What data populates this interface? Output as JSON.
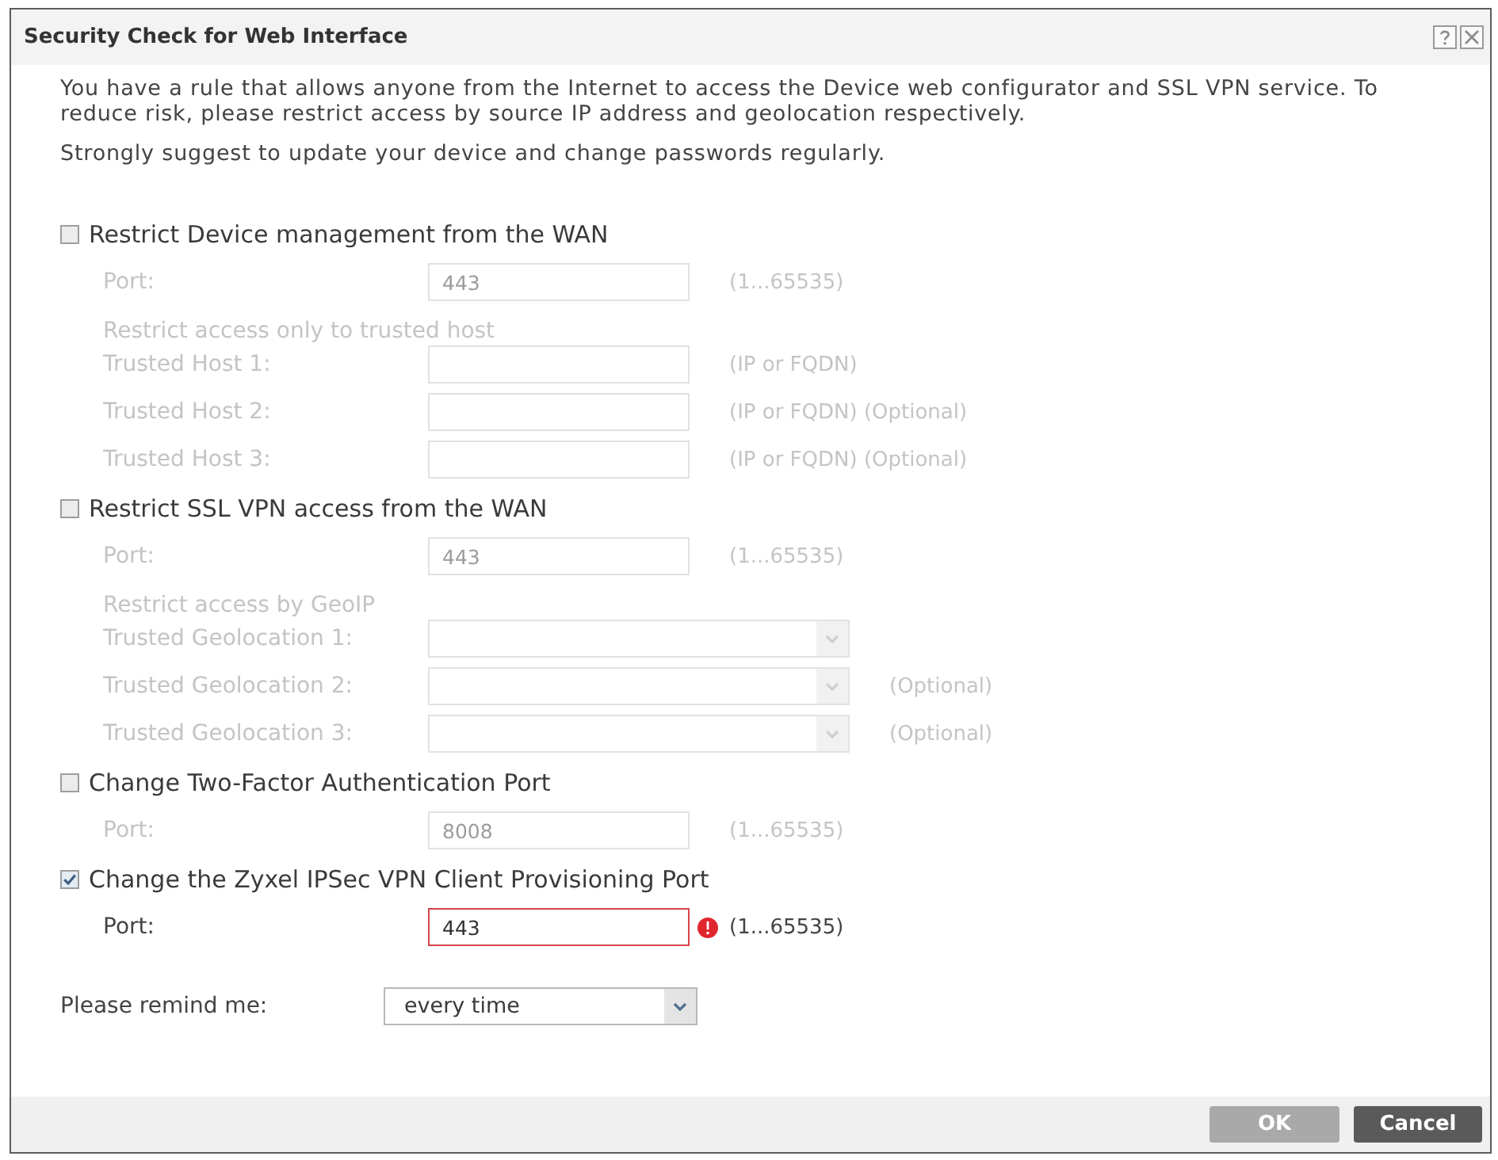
{
  "window": {
    "title": "Security Check for Web Interface"
  },
  "message": [
    "You have a rule that allows anyone from the Internet to access the Device web configurator and SSL VPN service. To reduce risk, please restrict access by source IP address and geolocation respectively.",
    "Strongly suggest to update your device and change passwords regularly."
  ],
  "sections": [
    {
      "label": "Restrict Device management from the WAN",
      "checked": false,
      "rows": [
        {
          "kind": "input",
          "label": "Port:",
          "value": "443",
          "hint": "(1...65535)",
          "error": false
        },
        {
          "kind": "note",
          "label": "Restrict access only to trusted host"
        },
        {
          "kind": "input",
          "label": "Trusted Host 1:",
          "hint": "(IP or FQDN)",
          "error": false
        },
        {
          "kind": "input",
          "label": "Trusted Host 2:",
          "hint": "(IP or FQDN) (Optional)",
          "error": false
        },
        {
          "kind": "input",
          "label": "Trusted Host 3:",
          "hint": "(IP or FQDN) (Optional)",
          "error": false
        }
      ]
    },
    {
      "label": "Restrict SSL VPN access from the WAN",
      "checked": false,
      "rows": [
        {
          "kind": "input",
          "label": "Port:",
          "value": "443",
          "hint": "(1...65535)",
          "error": false
        },
        {
          "kind": "note",
          "label": "Restrict access by GeoIP"
        },
        {
          "kind": "select",
          "label": "Trusted Geolocation 1:"
        },
        {
          "kind": "select",
          "label": "Trusted Geolocation 2:",
          "hint": "(Optional)"
        },
        {
          "kind": "select",
          "label": "Trusted Geolocation 3:",
          "hint": "(Optional)"
        }
      ]
    },
    {
      "label": "Change Two-Factor Authentication Port",
      "checked": false,
      "rows": [
        {
          "kind": "input",
          "label": "Port:",
          "value": "8008",
          "hint": "(1...65535)",
          "error": false
        }
      ]
    },
    {
      "label": "Change the Zyxel IPSec VPN Client Provisioning Port",
      "checked": true,
      "rows": [
        {
          "kind": "input",
          "label": "Port:",
          "value": "443",
          "hint": "(1...65535)",
          "error": true
        }
      ]
    }
  ],
  "remind": {
    "label": "Please remind me:",
    "value": "every time"
  },
  "buttons": [
    {
      "label": "OK",
      "disabled": true
    },
    {
      "label": "Cancel",
      "disabled": false
    }
  ]
}
